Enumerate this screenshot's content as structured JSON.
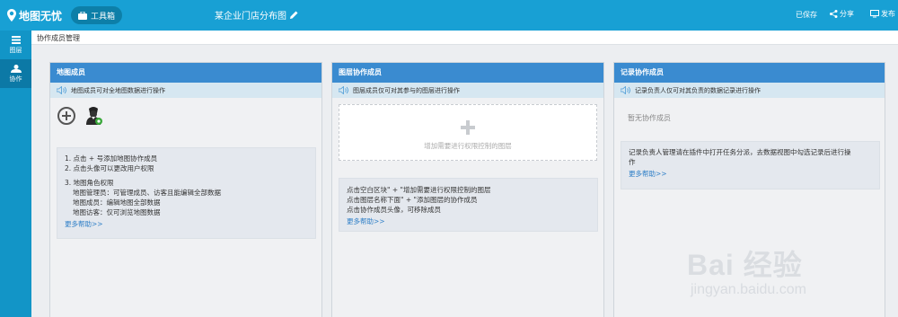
{
  "app": {
    "logo_text": "地图无忧",
    "toolbox_label": "工具箱",
    "map_title": "某企业门店分布图",
    "saved_status": "已保存",
    "share_label": "分享",
    "publish_label": "发布"
  },
  "sidebar": {
    "items": [
      {
        "label": "图层",
        "icon": "layers-icon"
      },
      {
        "label": "协作",
        "icon": "collaborator-icon"
      }
    ]
  },
  "page": {
    "title": "协作成员管理"
  },
  "panels": {
    "map_members": {
      "header": "地图成员",
      "notice": "地图成员可对全地图数据进行操作",
      "help": [
        "1. 点击 + 号添加地图协作成员",
        "2. 点击头像可以更改用户权限",
        "3. 地图角色权限",
        "地图管理员：可管理成员、访客且能编辑全部数据",
        "地图成员：编辑地图全部数据",
        "地图访客：仅可浏览地图数据"
      ],
      "more_help": "更多帮助>>"
    },
    "layer_members": {
      "header": "图层协作成员",
      "notice": "图层成员仅可对其参与的图层进行操作",
      "dashed_label": "增加需要进行权限控制的图层",
      "help": [
        "点击空白区块\" + \"增加需要进行权限控制的图层",
        "点击图层名称下面\" + \"添加图层的协作成员",
        "点击协作成员头像，可移除成员"
      ],
      "more_help": "更多帮助>>"
    },
    "record_members": {
      "header": "记录协作成员",
      "notice": "记录负责人仅可对其负责的数据记录进行操作",
      "empty_text": "暂无协作成员",
      "help": [
        "记录负责人管理请在插件中打开任务分派，去数据视图中勾选记录后进行操",
        "作"
      ],
      "more_help": "更多帮助>>"
    }
  },
  "watermark": {
    "brand": "Bai 经验",
    "url": "jingyan.baidu.com"
  },
  "colors": {
    "topbar": "#18a0d4",
    "sidebar": "#1295c7",
    "panel_header": "#3a8bd0",
    "link": "#2d7ec7"
  }
}
